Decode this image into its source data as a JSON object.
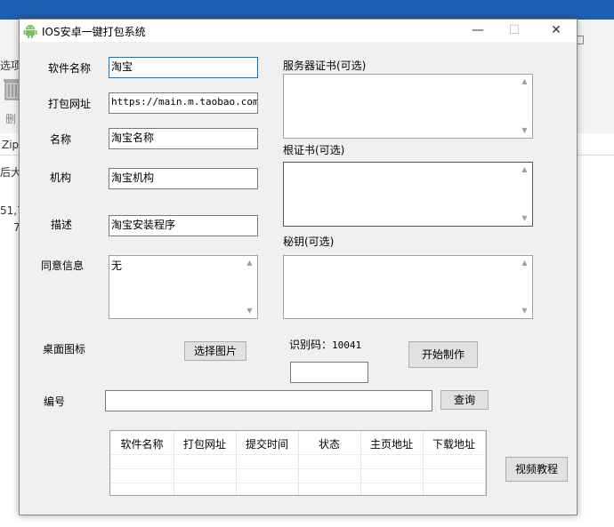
{
  "background": {
    "label_options": "选项",
    "label_delete": "删",
    "label_zip": "Zip",
    "label_after": "后大",
    "label_num1": "51,7",
    "label_num2": "7"
  },
  "window": {
    "title": "IOS安卓一键打包系统",
    "minimize": "—",
    "maximize": "☐",
    "close": "✕"
  },
  "form": {
    "software_name_label": "软件名称",
    "software_name_value": "淘宝",
    "package_url_label": "打包网址",
    "package_url_value": "https://main.m.taobao.com/",
    "name_label": "名称",
    "name_value": "淘宝名称",
    "org_label": "机构",
    "org_value": "淘宝机构",
    "desc_label": "描述",
    "desc_value": "淘宝安装程序",
    "agree_label": "同意信息",
    "agree_value": "无",
    "server_cert_label": "服务器证书(可选)",
    "root_cert_label": "根证书(可选)",
    "secret_key_label": "秘钥(可选)",
    "desktop_icon_label": "桌面图标",
    "choose_image_button": "选择图片",
    "captcha_label": "识别码：",
    "captcha_value": "10041",
    "captcha_input": "",
    "start_button": "开始制作",
    "serial_label": "编号",
    "serial_value": "",
    "query_button": "查询",
    "video_button": "视频教程"
  },
  "table": {
    "columns": [
      "软件名称",
      "打包网址",
      "提交时间",
      "状态",
      "主页地址",
      "下载地址"
    ]
  }
}
